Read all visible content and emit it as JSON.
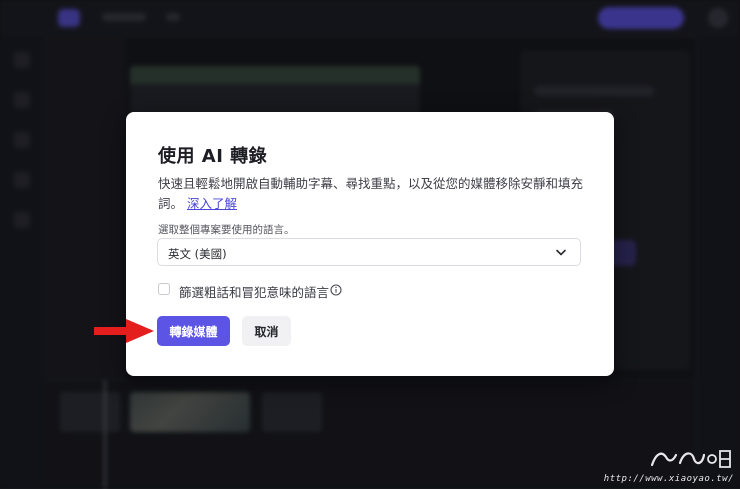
{
  "dialog": {
    "title": "使用 AI 轉錄",
    "description": "快速且輕鬆地開啟自動輔助字幕、尋找重點，以及從您的媒體移除安靜和填充詞。",
    "learn_more": "深入了解",
    "language_label": "選取整個專案要使用的語言。",
    "language_value": "英文 (美國)",
    "filter_label": "篩選粗話和冒犯意味的語言",
    "filter_checked": false,
    "transcribe_button": "轉錄媒體",
    "cancel_button": "取消"
  },
  "watermark": {
    "url": "http://www.xiaoyao.tw/"
  },
  "colors": {
    "accent": "#5c54e4",
    "link": "#4a46d8",
    "annotation_arrow": "#e41d1d"
  }
}
